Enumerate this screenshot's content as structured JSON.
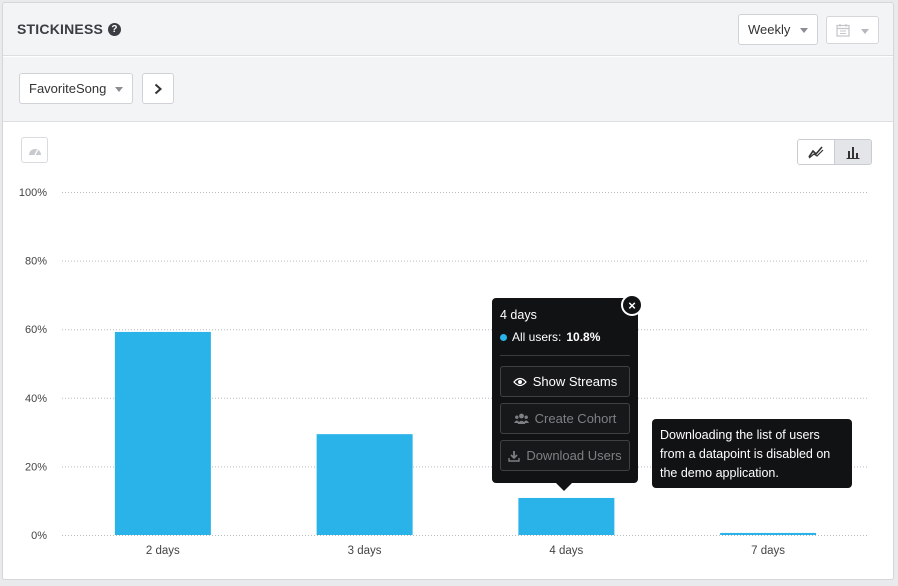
{
  "header": {
    "title": "STICKINESS",
    "period_select": "Weekly"
  },
  "filters": {
    "event_select": "FavoriteSong"
  },
  "colors": {
    "bar": "#29b3e8",
    "grid": "#b8bbbf"
  },
  "chart_data": {
    "type": "bar",
    "categories": [
      "2 days",
      "3 days",
      "4 days",
      "7 days"
    ],
    "values": [
      59.2,
      29.4,
      10.8,
      0.6
    ],
    "y_ticks": [
      "0%",
      "20%",
      "40%",
      "60%",
      "80%",
      "100%"
    ],
    "ylim": [
      0,
      100
    ],
    "grid": true
  },
  "tooltip": {
    "title": "4 days",
    "series_label": "All users:",
    "series_value": "10.8%",
    "buttons": {
      "show_streams": "Show Streams",
      "create_cohort": "Create Cohort",
      "download_users": "Download Users"
    }
  },
  "info_tip": {
    "text": "Downloading the list of users from a datapoint is disabled on the demo application."
  },
  "icons": [
    "help-icon",
    "calendar-icon",
    "chevron-right-icon",
    "dashboard-icon",
    "line-chart-icon",
    "bar-chart-icon",
    "eye-icon",
    "users-icon",
    "download-icon",
    "close-icon"
  ]
}
